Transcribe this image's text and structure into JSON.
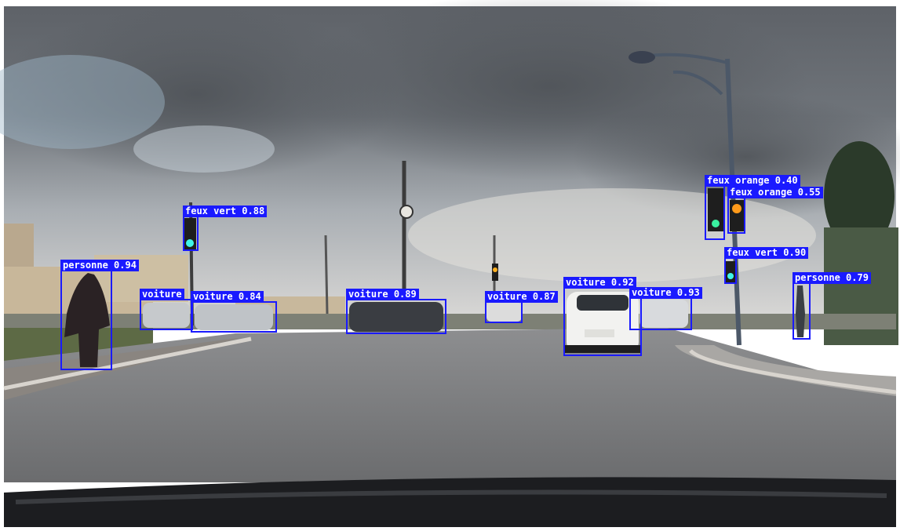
{
  "detections": [
    {
      "id": "d1",
      "class": "personne",
      "score": "0.94"
    },
    {
      "id": "d2",
      "class": "feux vert",
      "score": "0.88"
    },
    {
      "id": "d3",
      "class": "voiture",
      "score": "0.84"
    },
    {
      "id": "d4",
      "class": "voiture",
      "score": ""
    },
    {
      "id": "d5",
      "class": "voiture",
      "score": "0.89"
    },
    {
      "id": "d6",
      "class": "voiture",
      "score": "0.87"
    },
    {
      "id": "d7",
      "class": "voiture",
      "score": "0.92"
    },
    {
      "id": "d8",
      "class": "voiture",
      "score": "0.93"
    },
    {
      "id": "d9",
      "class": "feux orange",
      "score": "0.40"
    },
    {
      "id": "d10",
      "class": "feux orange",
      "score": "0.55"
    },
    {
      "id": "d11",
      "class": "feux vert",
      "score": "0.90"
    },
    {
      "id": "d12",
      "class": "personne",
      "score": "0.79"
    }
  ],
  "colors": {
    "box": "#1a1aff",
    "label_text": "#ffffff"
  }
}
